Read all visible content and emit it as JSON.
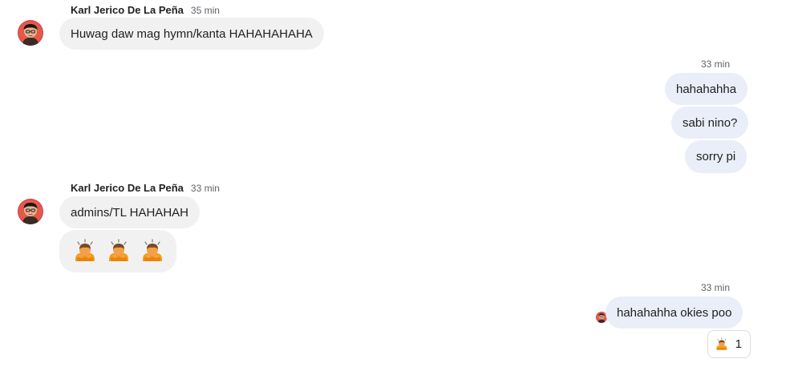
{
  "messages": {
    "group1": {
      "sender": "Karl Jerico De La Peña",
      "time": "35 min",
      "texts": [
        "Huwag daw mag hymn/kanta HAHAHAHAHA"
      ]
    },
    "group2": {
      "time": "33 min",
      "texts": [
        "hahahahha",
        "sabi nino?",
        "sorry pi"
      ]
    },
    "group3": {
      "sender": "Karl Jerico De La Peña",
      "time": "33 min",
      "texts": [
        "admins/TL HAHAHAH"
      ],
      "emoji_count": 3
    },
    "group4": {
      "time": "33 min",
      "texts": [
        "hahahahha okies poo"
      ],
      "reaction": {
        "icon": "person-bowing-emoji-icon",
        "count": "1"
      }
    }
  },
  "colors": {
    "incoming_bubble": "#f1f1f1",
    "outgoing_bubble": "#e9eef8",
    "muted_text": "#5f6368"
  }
}
